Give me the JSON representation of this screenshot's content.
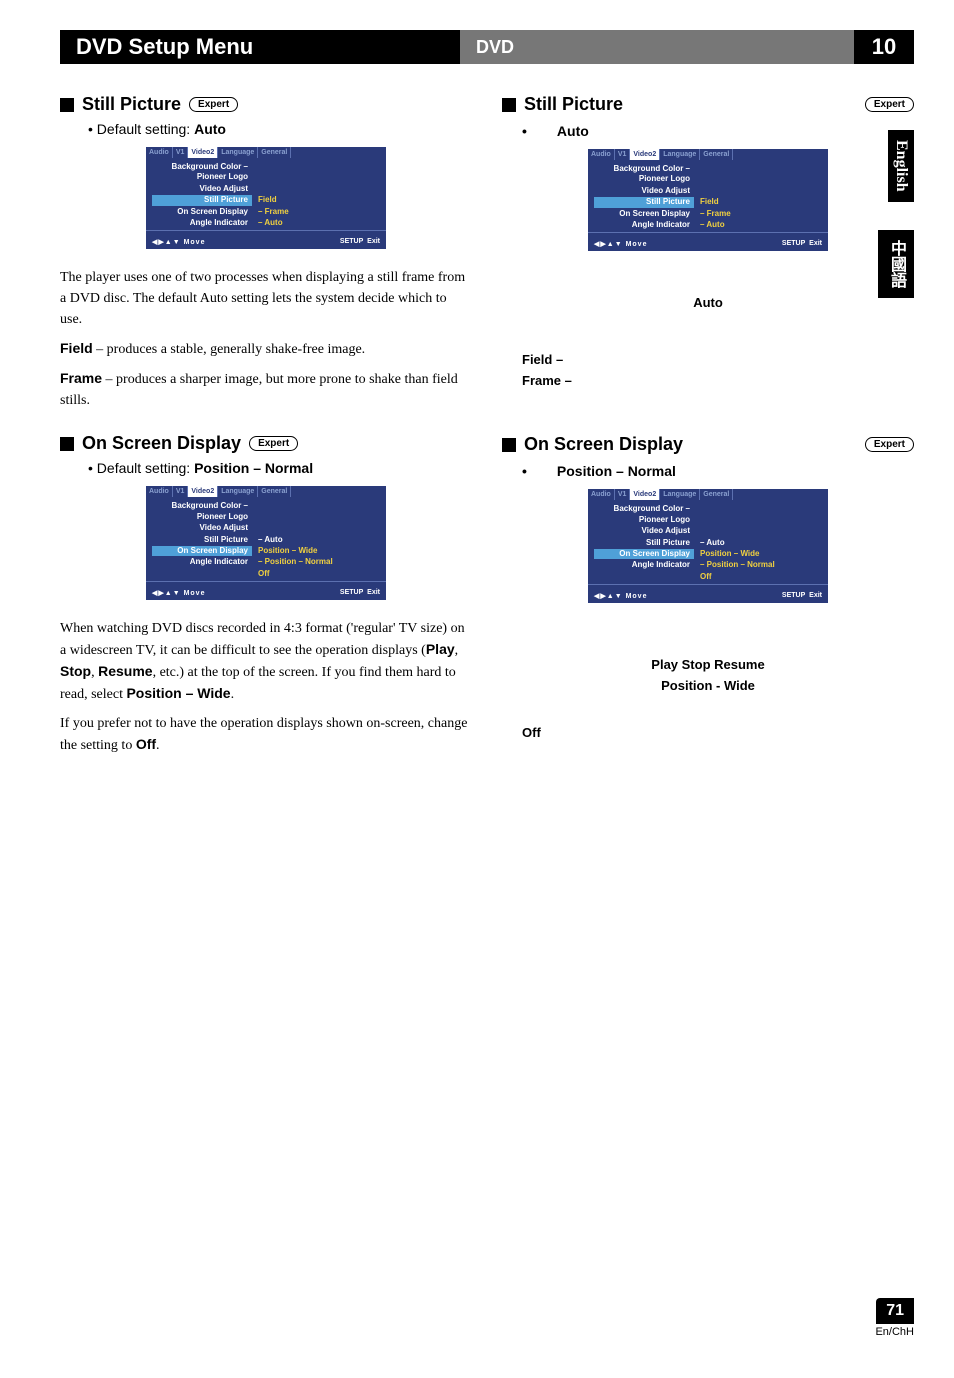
{
  "header": {
    "title": "DVD Setup Menu",
    "mid": "DVD",
    "chapter": "10"
  },
  "side_tabs": {
    "english": "English",
    "cjk": "中國語"
  },
  "page_footer": {
    "number": "71",
    "langs": "En/ChH"
  },
  "sec1": {
    "title": "Still Picture",
    "pill": "Expert",
    "default_label": "• Default setting: ",
    "default_value": "Auto",
    "para1": "The player uses one of two processes when displaying a still frame from a DVD disc. The default Auto setting lets the system decide which to use.",
    "field_label": "Field",
    "field_text": " – produces a stable, generally shake-free image.",
    "frame_label": "Frame",
    "frame_text": " – produces a sharper image, but more prone to shake than field stills."
  },
  "sec2": {
    "title": "On Screen Display",
    "pill": "Expert",
    "default_label": "• Default setting: ",
    "default_value": "Position – Normal",
    "para1_a": "When watching DVD discs recorded in 4:3 format ('regular' TV size) on a widescreen TV, it can be difficult to see the operation displays (",
    "para1_b": "Play",
    "para1_c": ", ",
    "para1_d": "Stop",
    "para1_e": ", ",
    "para1_f": "Resume",
    "para1_g": ", etc.) at the top of the screen. If you find them hard to read, select ",
    "para1_h": "Position – Wide",
    "para1_i": ".",
    "para2_a": "If you prefer not to have the operation displays shown on-screen, change the setting to ",
    "para2_b": "Off",
    "para2_c": "."
  },
  "r1": {
    "title": "Still Picture",
    "pill": "Expert",
    "bullet": "•",
    "default_value": "Auto",
    "auto_line": "Auto",
    "field": "Field –",
    "frame": "Frame –"
  },
  "r2": {
    "title": "On Screen Display",
    "pill": "Expert",
    "bullet": "•",
    "default_value": "Position – Normal",
    "line1": "Play   Stop   Resume",
    "line2": "Position - Wide",
    "off": "Off"
  },
  "osd": {
    "tabs": {
      "audio": "Audio",
      "v1": "V1",
      "video2": "Video2",
      "language": "Language",
      "general": "General"
    },
    "bg": "Background Color – Pioneer Logo",
    "va": "Video Adjust",
    "sp_label": "Still Picture",
    "sp_field": "Field",
    "sp_auto": "– Auto",
    "osd_label": "On Screen Display",
    "osd_frame": "–  Frame",
    "osd_pos_wide": "Position – Wide",
    "ai_label": "Angle Indicator",
    "ai_auto": "–  Auto",
    "ai_pos_normal": "–  Position – Normal",
    "off": "Off",
    "footer_left": "◀▶▲▼ Move",
    "footer_setup": "SETUP",
    "footer_exit": "Exit"
  }
}
